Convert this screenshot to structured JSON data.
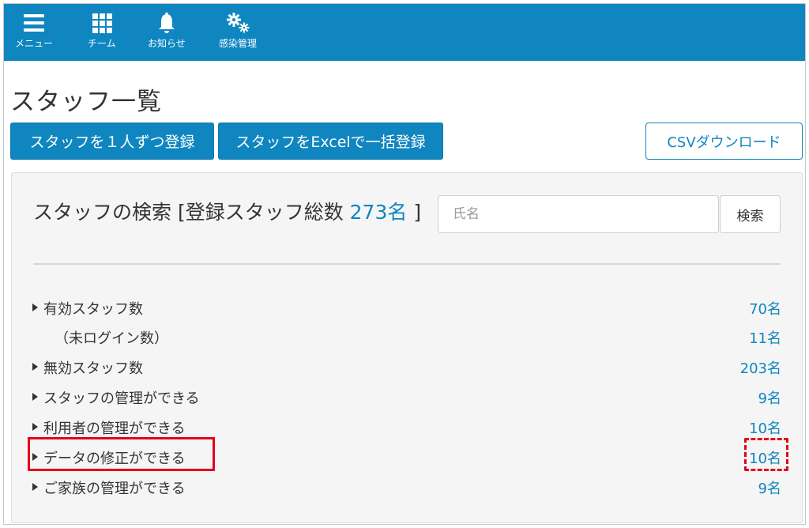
{
  "nav": {
    "items": [
      {
        "label": "メニュー",
        "icon": "hamburger-menu-icon"
      },
      {
        "label": "チーム",
        "icon": "grid-icon"
      },
      {
        "label": "お知らせ",
        "icon": "bell-icon"
      },
      {
        "label": "感染管理",
        "icon": "gears-icon"
      }
    ]
  },
  "page": {
    "title": "スタッフ一覧"
  },
  "actions": {
    "register_one": "スタッフを１人ずつ登録",
    "register_excel": "スタッフをExcelで一括登録",
    "csv_download": "CSVダウンロード"
  },
  "search": {
    "heading_prefix": "スタッフの検索 [登録スタッフ総数 ",
    "total_count": "273名",
    "heading_suffix": " ]",
    "placeholder": "氏名",
    "value": "",
    "button_label": "検索"
  },
  "stats": [
    {
      "label": "有効スタッフ数",
      "value": "70名",
      "arrow": true
    },
    {
      "label": "（未ログイン数）",
      "value": "11名",
      "arrow": false
    },
    {
      "label": "無効スタッフ数",
      "value": "203名",
      "arrow": true
    },
    {
      "label": "スタッフの管理ができる",
      "value": "9名",
      "arrow": true
    },
    {
      "label": "利用者の管理ができる",
      "value": "10名",
      "arrow": true
    },
    {
      "label": "データの修正ができる",
      "value": "10名",
      "arrow": true
    },
    {
      "label": "ご家族の管理ができる",
      "value": "9名",
      "arrow": true
    }
  ],
  "colors": {
    "brand": "#0f86c0",
    "highlight": "#e3001b",
    "panel_bg": "#f5f5f5"
  }
}
